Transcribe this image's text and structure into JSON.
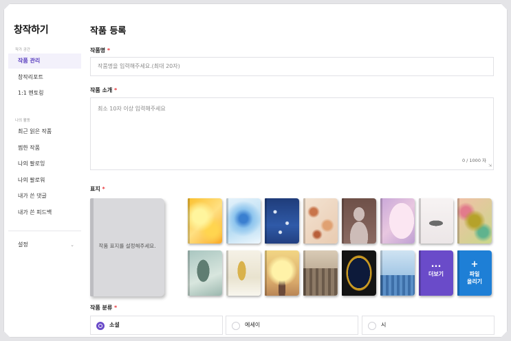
{
  "sidebar": {
    "title": "창작하기",
    "section_workspace": "작가 공간",
    "workspace_items": [
      "작품 관리",
      "창작리포트",
      "1:1 멘토링"
    ],
    "section_activity": "나의 활동",
    "activity_items": [
      "최근 읽은 작품",
      "찜한 작품",
      "나의 팔로잉",
      "나의 팔로워",
      "내가 쓴 댓글",
      "내가 쓴 피드백"
    ],
    "settings": "설정",
    "settings_icon": "chevron-down-icon"
  },
  "main": {
    "title": "작품 등록",
    "title_field": {
      "label": "작품명",
      "required_mark": "*",
      "placeholder": "작품명을 입력해주세요.(최대 20자)"
    },
    "intro_field": {
      "label": "작품 소개",
      "required_mark": "*",
      "placeholder": "최소 10자 이상 입력해주세요",
      "counter": "0 / 1000 자"
    },
    "cover": {
      "label": "표지",
      "required_mark": "*",
      "preview_text": "작품 표지를 설정해주세요.",
      "more_icon": "...",
      "more_label": "더보기",
      "upload_icon": "+",
      "upload_label": "파일\n올리기",
      "more_color": "#6a4bc9",
      "upload_color": "#1e7fd6"
    },
    "category": {
      "label": "작품 분류",
      "required_mark": "*",
      "options": [
        "소설",
        "에세이",
        "시"
      ],
      "selected": "소설",
      "accent": "#6a4bc9"
    }
  }
}
